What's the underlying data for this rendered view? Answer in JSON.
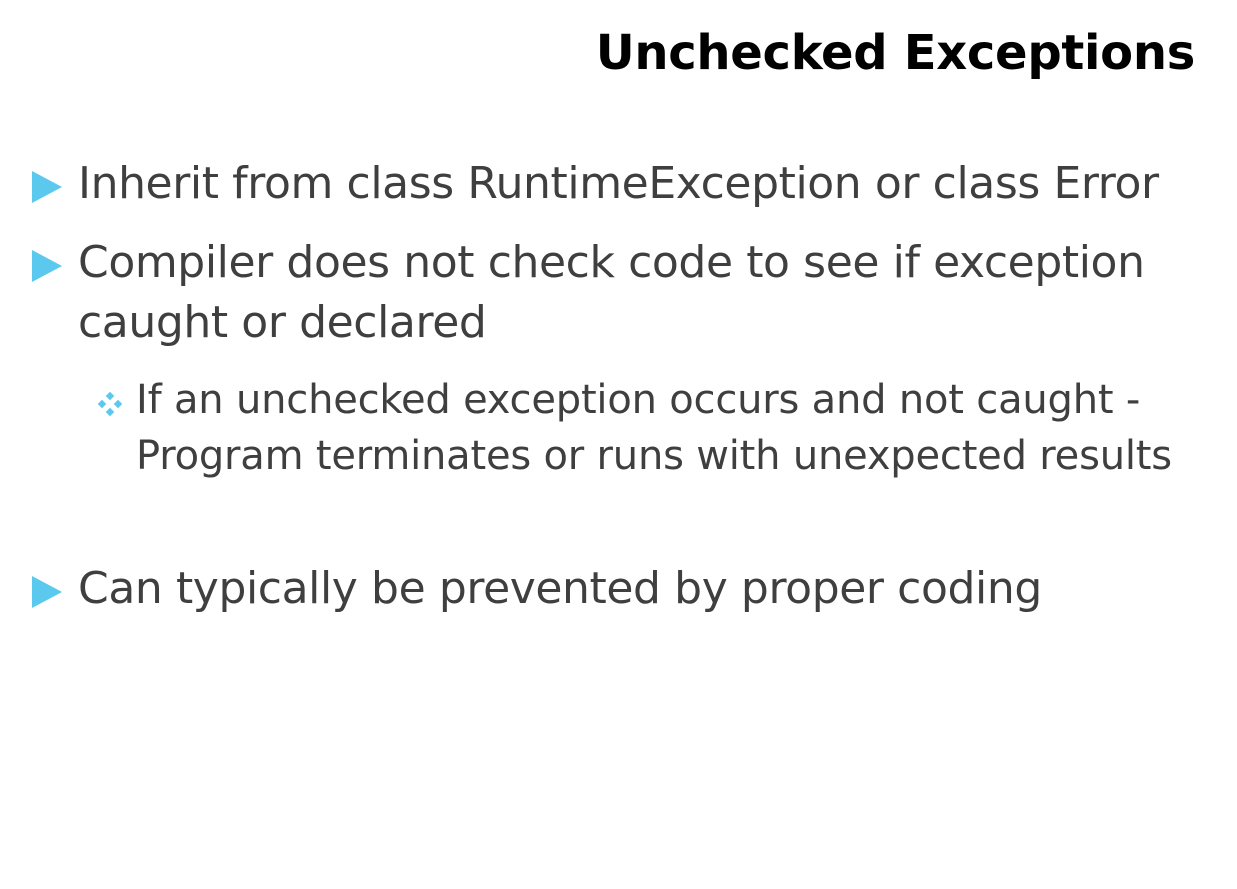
{
  "slide": {
    "title": "Unchecked Exceptions",
    "bullets": [
      {
        "text": "Inherit from class RuntimeException or class Error",
        "icon": "triangle-bullet-icon"
      },
      {
        "text": "Compiler does not check code to see if exception caught or declared",
        "icon": "triangle-bullet-icon",
        "sub_bullets": [
          {
            "text": "If an unchecked exception occurs and not caught - Program terminates or runs with unexpected results",
            "icon": "diamond-dots-bullet-icon"
          }
        ]
      },
      {
        "text": "Can typically be prevented by proper coding",
        "icon": "triangle-bullet-icon"
      }
    ]
  },
  "colors": {
    "bullet_accent": "#5bc8ee",
    "title_text": "#000000",
    "body_text": "#3f3f3f",
    "background": "#ffffff"
  }
}
